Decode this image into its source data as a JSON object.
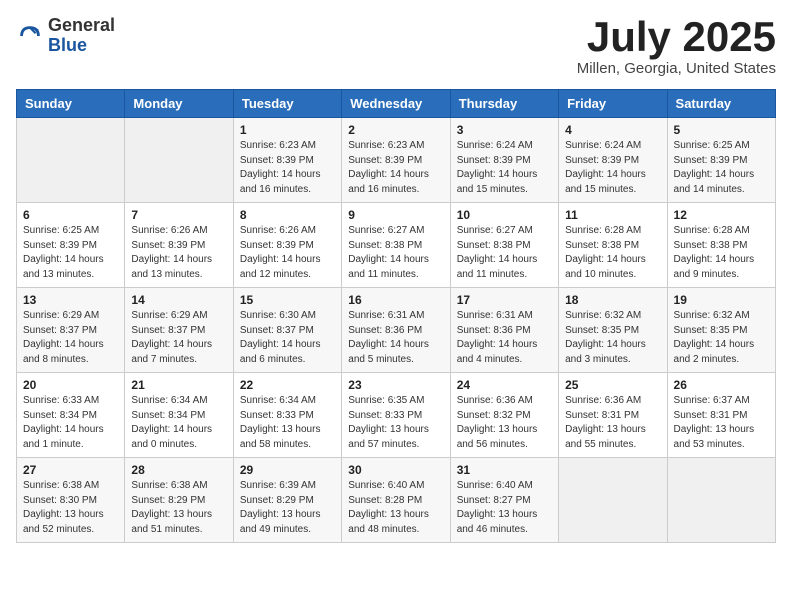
{
  "header": {
    "logo": {
      "general": "General",
      "blue": "Blue"
    },
    "month": "July 2025",
    "location": "Millen, Georgia, United States"
  },
  "weekdays": [
    "Sunday",
    "Monday",
    "Tuesday",
    "Wednesday",
    "Thursday",
    "Friday",
    "Saturday"
  ],
  "weeks": [
    [
      {
        "day": "",
        "info": ""
      },
      {
        "day": "",
        "info": ""
      },
      {
        "day": "1",
        "info": "Sunrise: 6:23 AM\nSunset: 8:39 PM\nDaylight: 14 hours and 16 minutes."
      },
      {
        "day": "2",
        "info": "Sunrise: 6:23 AM\nSunset: 8:39 PM\nDaylight: 14 hours and 16 minutes."
      },
      {
        "day": "3",
        "info": "Sunrise: 6:24 AM\nSunset: 8:39 PM\nDaylight: 14 hours and 15 minutes."
      },
      {
        "day": "4",
        "info": "Sunrise: 6:24 AM\nSunset: 8:39 PM\nDaylight: 14 hours and 15 minutes."
      },
      {
        "day": "5",
        "info": "Sunrise: 6:25 AM\nSunset: 8:39 PM\nDaylight: 14 hours and 14 minutes."
      }
    ],
    [
      {
        "day": "6",
        "info": "Sunrise: 6:25 AM\nSunset: 8:39 PM\nDaylight: 14 hours and 13 minutes."
      },
      {
        "day": "7",
        "info": "Sunrise: 6:26 AM\nSunset: 8:39 PM\nDaylight: 14 hours and 13 minutes."
      },
      {
        "day": "8",
        "info": "Sunrise: 6:26 AM\nSunset: 8:39 PM\nDaylight: 14 hours and 12 minutes."
      },
      {
        "day": "9",
        "info": "Sunrise: 6:27 AM\nSunset: 8:38 PM\nDaylight: 14 hours and 11 minutes."
      },
      {
        "day": "10",
        "info": "Sunrise: 6:27 AM\nSunset: 8:38 PM\nDaylight: 14 hours and 11 minutes."
      },
      {
        "day": "11",
        "info": "Sunrise: 6:28 AM\nSunset: 8:38 PM\nDaylight: 14 hours and 10 minutes."
      },
      {
        "day": "12",
        "info": "Sunrise: 6:28 AM\nSunset: 8:38 PM\nDaylight: 14 hours and 9 minutes."
      }
    ],
    [
      {
        "day": "13",
        "info": "Sunrise: 6:29 AM\nSunset: 8:37 PM\nDaylight: 14 hours and 8 minutes."
      },
      {
        "day": "14",
        "info": "Sunrise: 6:29 AM\nSunset: 8:37 PM\nDaylight: 14 hours and 7 minutes."
      },
      {
        "day": "15",
        "info": "Sunrise: 6:30 AM\nSunset: 8:37 PM\nDaylight: 14 hours and 6 minutes."
      },
      {
        "day": "16",
        "info": "Sunrise: 6:31 AM\nSunset: 8:36 PM\nDaylight: 14 hours and 5 minutes."
      },
      {
        "day": "17",
        "info": "Sunrise: 6:31 AM\nSunset: 8:36 PM\nDaylight: 14 hours and 4 minutes."
      },
      {
        "day": "18",
        "info": "Sunrise: 6:32 AM\nSunset: 8:35 PM\nDaylight: 14 hours and 3 minutes."
      },
      {
        "day": "19",
        "info": "Sunrise: 6:32 AM\nSunset: 8:35 PM\nDaylight: 14 hours and 2 minutes."
      }
    ],
    [
      {
        "day": "20",
        "info": "Sunrise: 6:33 AM\nSunset: 8:34 PM\nDaylight: 14 hours and 1 minute."
      },
      {
        "day": "21",
        "info": "Sunrise: 6:34 AM\nSunset: 8:34 PM\nDaylight: 14 hours and 0 minutes."
      },
      {
        "day": "22",
        "info": "Sunrise: 6:34 AM\nSunset: 8:33 PM\nDaylight: 13 hours and 58 minutes."
      },
      {
        "day": "23",
        "info": "Sunrise: 6:35 AM\nSunset: 8:33 PM\nDaylight: 13 hours and 57 minutes."
      },
      {
        "day": "24",
        "info": "Sunrise: 6:36 AM\nSunset: 8:32 PM\nDaylight: 13 hours and 56 minutes."
      },
      {
        "day": "25",
        "info": "Sunrise: 6:36 AM\nSunset: 8:31 PM\nDaylight: 13 hours and 55 minutes."
      },
      {
        "day": "26",
        "info": "Sunrise: 6:37 AM\nSunset: 8:31 PM\nDaylight: 13 hours and 53 minutes."
      }
    ],
    [
      {
        "day": "27",
        "info": "Sunrise: 6:38 AM\nSunset: 8:30 PM\nDaylight: 13 hours and 52 minutes."
      },
      {
        "day": "28",
        "info": "Sunrise: 6:38 AM\nSunset: 8:29 PM\nDaylight: 13 hours and 51 minutes."
      },
      {
        "day": "29",
        "info": "Sunrise: 6:39 AM\nSunset: 8:29 PM\nDaylight: 13 hours and 49 minutes."
      },
      {
        "day": "30",
        "info": "Sunrise: 6:40 AM\nSunset: 8:28 PM\nDaylight: 13 hours and 48 minutes."
      },
      {
        "day": "31",
        "info": "Sunrise: 6:40 AM\nSunset: 8:27 PM\nDaylight: 13 hours and 46 minutes."
      },
      {
        "day": "",
        "info": ""
      },
      {
        "day": "",
        "info": ""
      }
    ]
  ]
}
